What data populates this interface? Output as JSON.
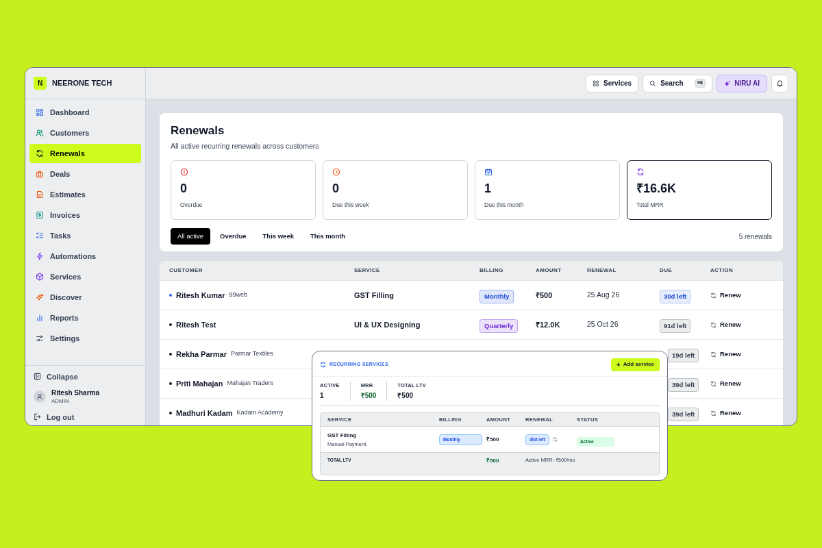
{
  "brand": {
    "logo": "N",
    "name": "NEERONE TECH"
  },
  "sidebar": {
    "items": [
      {
        "label": "Dashboard",
        "selected": false
      },
      {
        "label": "Customers",
        "selected": false
      },
      {
        "label": "Renewals",
        "selected": true
      },
      {
        "label": "Deals",
        "selected": false
      },
      {
        "label": "Estimates",
        "selected": false
      },
      {
        "label": "Invoices",
        "selected": false
      },
      {
        "label": "Tasks",
        "selected": false
      },
      {
        "label": "Automations",
        "selected": false
      },
      {
        "label": "Services",
        "selected": false
      },
      {
        "label": "Discover",
        "selected": false
      },
      {
        "label": "Reports",
        "selected": false
      },
      {
        "label": "Settings",
        "selected": false
      }
    ],
    "collapse": "Collapse",
    "user": {
      "name": "Ritesh Sharma",
      "role": "ADMIN"
    },
    "logout": "Log out"
  },
  "topbar": {
    "services": "Services",
    "search": "Search",
    "shortcut": "⌘K",
    "ai": "NIRU AI"
  },
  "header": {
    "title": "Renewals",
    "subtitle": "All active recurring renewals across customers"
  },
  "stats": [
    {
      "value": "0",
      "label": "Overdue",
      "selected": false
    },
    {
      "value": "0",
      "label": "Due this week",
      "selected": false
    },
    {
      "value": "1",
      "label": "Due this month",
      "selected": false
    },
    {
      "value": "₹16.6K",
      "label": "Total MRR",
      "selected": true
    }
  ],
  "filters": [
    {
      "label": "All active",
      "selected": true
    },
    {
      "label": "Overdue",
      "selected": false
    },
    {
      "label": "This week",
      "selected": false
    },
    {
      "label": "This month",
      "selected": false
    }
  ],
  "count": "5 renewals",
  "table": {
    "columns": [
      "CUSTOMER",
      "SERVICE",
      "BILLING",
      "AMOUNT",
      "RENEWAL",
      "DUE",
      "ACTION"
    ],
    "rows": [
      {
        "customer": "Ritesh Kumar",
        "company": "99web",
        "color": "#2563eb",
        "service": "GST Filling",
        "billing": {
          "text": "Monthly",
          "color": "#1d4ed8"
        },
        "amount": "₹500",
        "renewal": "25 Aug 26",
        "due": {
          "text": "30d left",
          "color": "#1d4ed8"
        },
        "action": "Renew"
      },
      {
        "customer": "Ritesh Test",
        "color": "#111827",
        "service": "UI & UX Designing",
        "billing": {
          "text": "Quarterly",
          "color": "#6d28d9"
        },
        "amount": "₹12.0K",
        "renewal": "25 Oct 26",
        "due": {
          "text": "91d left",
          "color": "#374151"
        },
        "action": "Renew"
      },
      {
        "customer": "Rekha Parmar",
        "company": "Parmar Textiles",
        "color": "#111827",
        "due": {
          "text": "19d left",
          "color": "#374151"
        },
        "action": "Renew"
      },
      {
        "customer": "Priti Mahajan",
        "company": "Mahajan Traders",
        "color": "#111827",
        "due": {
          "text": "39d left",
          "color": "#374151"
        },
        "action": "Renew"
      },
      {
        "customer": "Madhuri Kadam",
        "company": "Kadam Academy",
        "color": "#111827",
        "due": {
          "text": "39d left",
          "color": "#374151"
        },
        "action": "Renew"
      }
    ]
  },
  "popup": {
    "title": "RECURRING SERVICES",
    "add": "Add service",
    "plus": "+",
    "stats": [
      {
        "label": "ACTIVE",
        "value": "1",
        "color": "#111827"
      },
      {
        "label": "MRR",
        "value": "₹500",
        "color": "#166534"
      },
      {
        "label": "TOTAL LTV",
        "value": "₹500",
        "color": "#111827"
      }
    ],
    "columns": [
      "SERVICE",
      "BILLING",
      "AMOUNT",
      "RENEWAL",
      "STATUS"
    ],
    "row": {
      "service": "GST Filling",
      "note": "Manual Payment.",
      "billing": "Monthly",
      "amount": "₹500",
      "due": "30d left",
      "status": "Active"
    },
    "footer": {
      "label": "TOTAL LTV",
      "amount": "₹500",
      "mrr": "Active MRR: ₹500/mo"
    }
  }
}
